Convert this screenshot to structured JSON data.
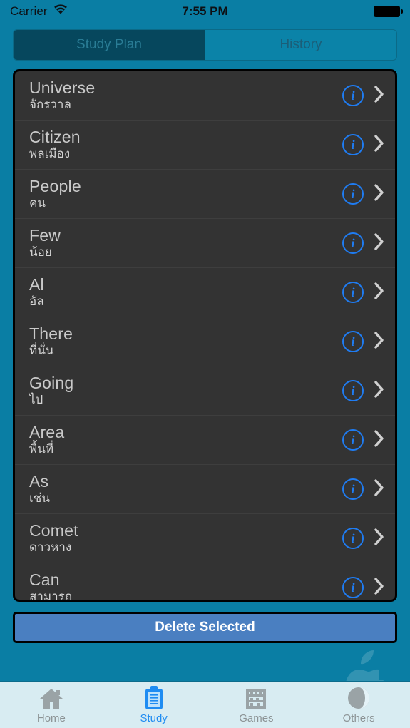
{
  "status_bar": {
    "carrier": "Carrier",
    "time": "7:55 PM",
    "wifi_icon": "wifi-icon",
    "battery_icon": "battery-full-icon"
  },
  "segmented_control": {
    "selected": "Study Plan",
    "options": [
      {
        "label": "Study Plan",
        "active": true
      },
      {
        "label": "History",
        "active": false
      }
    ]
  },
  "list": {
    "info_icon": "info-circle-icon",
    "chevron_icon": "chevron-right-icon",
    "rows": [
      {
        "title": "Universe",
        "sub": "จักรวาล"
      },
      {
        "title": "Citizen",
        "sub": "พลเมือง"
      },
      {
        "title": "People",
        "sub": "คน"
      },
      {
        "title": "Few",
        "sub": "น้อย"
      },
      {
        "title": "Al",
        "sub": "อัล"
      },
      {
        "title": "There",
        "sub": "ที่นั่น"
      },
      {
        "title": "Going",
        "sub": "ไป"
      },
      {
        "title": "Area",
        "sub": "พื้นที่"
      },
      {
        "title": "As",
        "sub": "เช่น"
      },
      {
        "title": "Comet",
        "sub": "ดาวหาง"
      },
      {
        "title": "Can",
        "sub": "สามารถ"
      }
    ]
  },
  "delete_button": {
    "label": "Delete Selected"
  },
  "tab_bar": {
    "items": [
      {
        "label": "Home",
        "icon": "home-icon",
        "active": false
      },
      {
        "label": "Study",
        "icon": "clipboard-icon",
        "active": true
      },
      {
        "label": "Games",
        "icon": "abacus-icon",
        "active": false
      },
      {
        "label": "Others",
        "icon": "pie-circle-icon",
        "active": false
      }
    ]
  },
  "colors": {
    "background": "#0a7ea4",
    "segment_active": "#06475d",
    "list_background": "#333333",
    "accent_blue": "#1f7cf2",
    "delete_button": "#4a7fc1",
    "tabbar_background": "#d8ecf2"
  }
}
